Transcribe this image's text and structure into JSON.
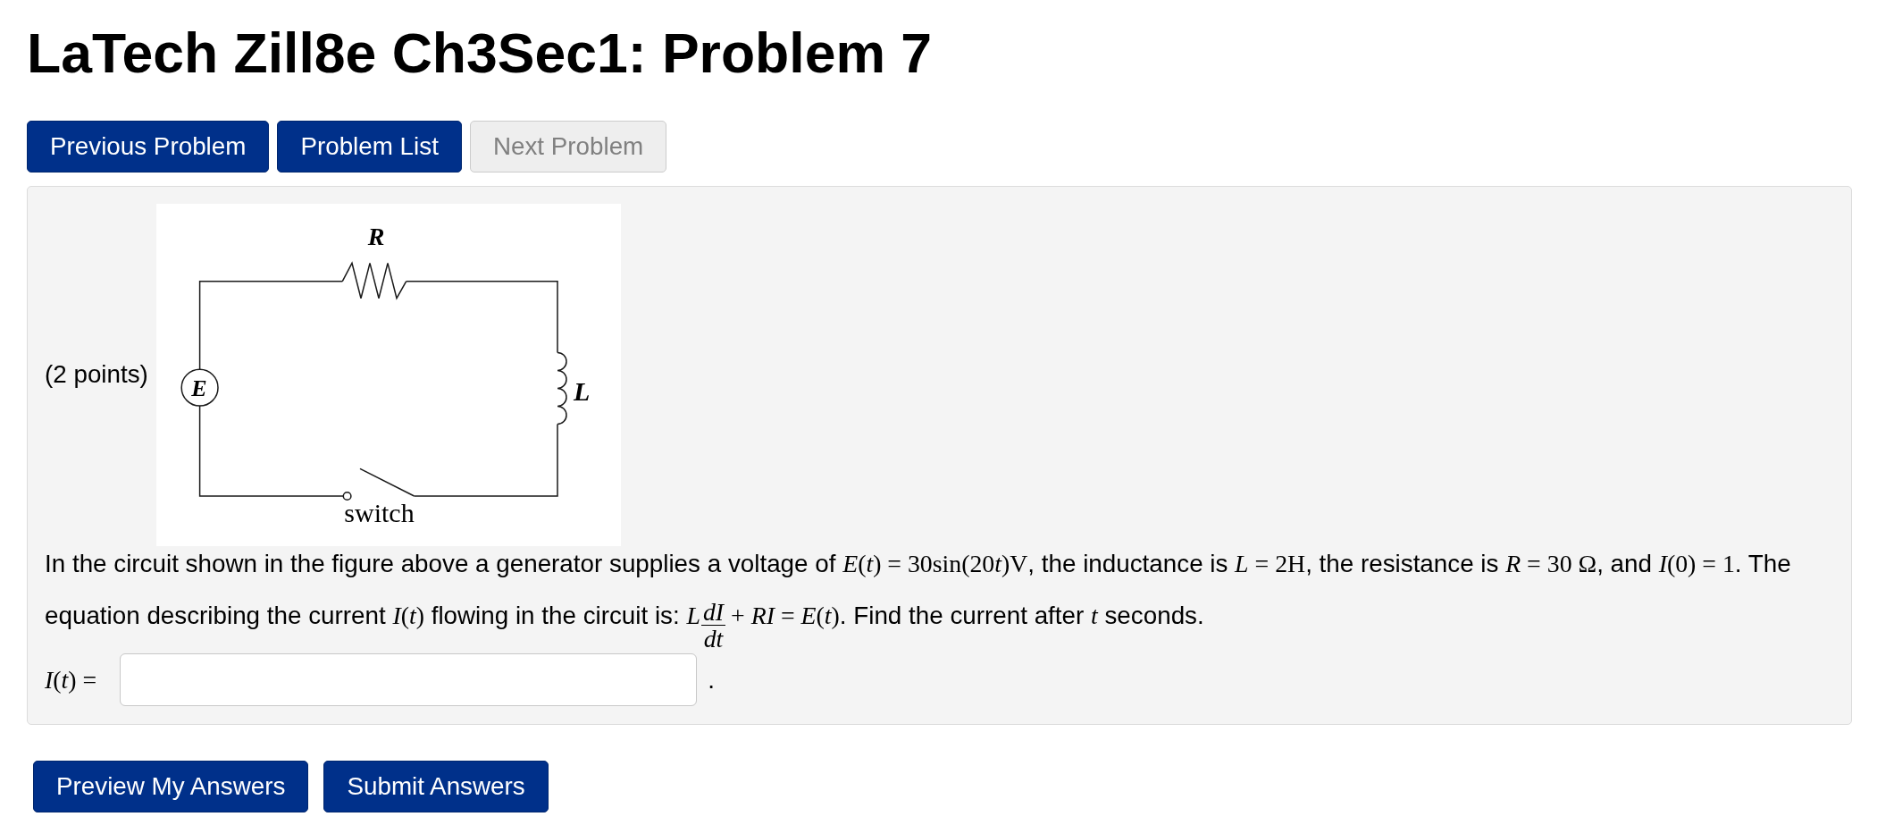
{
  "title": "LaTech Zill8e Ch3Sec1: Problem 7",
  "nav_buttons": [
    {
      "label": "Previous Problem",
      "disabled": false
    },
    {
      "label": "Problem List",
      "disabled": false
    },
    {
      "label": "Next Problem",
      "disabled": true
    }
  ],
  "problem": {
    "points": "(2 points)",
    "figure": {
      "components": [
        {
          "kind": "resistor",
          "label": "R"
        },
        {
          "kind": "source",
          "label": "E"
        },
        {
          "kind": "inductor",
          "label": "L"
        },
        {
          "kind": "switch",
          "label": "switch",
          "closed": false
        }
      ]
    },
    "statement": [
      {
        "kind": "text",
        "text": "In the circuit shown in the figure above a generator supplies a voltage of "
      },
      {
        "kind": "math",
        "text": "*E*(*t*) = 30sin(20"
      },
      {
        "kind": "math",
        "text": "*t*)V"
      },
      {
        "kind": "text",
        "text": ", the inductance is "
      },
      {
        "kind": "math",
        "text": "*L* = 2H"
      },
      {
        "kind": "text",
        "text": ", the resistance is "
      },
      {
        "kind": "math",
        "text": "*R* = 30 Ω"
      },
      {
        "kind": "text",
        "text": ", and "
      },
      {
        "kind": "math",
        "text": "*I*(0) = 1"
      },
      {
        "kind": "text",
        "text": ". The equation describing the current "
      },
      {
        "kind": "math",
        "text": "*I*(*t*)"
      },
      {
        "kind": "text",
        "text": " flowing in the circuit is: "
      },
      {
        "kind": "math",
        "text": "*L*"
      },
      {
        "kind": "fraction",
        "numerator": "*dI*",
        "denominator": "*dt*"
      },
      {
        "kind": "math",
        "text": "+ *RI* = *E*(*t*)"
      },
      {
        "kind": "text",
        "text": ". Find the current after "
      },
      {
        "kind": "math",
        "text": "*t*"
      },
      {
        "kind": "text",
        "text": " seconds."
      }
    ],
    "answer": {
      "label": "*I*(*t*) =",
      "suffix": "."
    }
  },
  "action_buttons": [
    {
      "label": "Preview My Answers"
    },
    {
      "label": "Submit Answers"
    }
  ]
}
